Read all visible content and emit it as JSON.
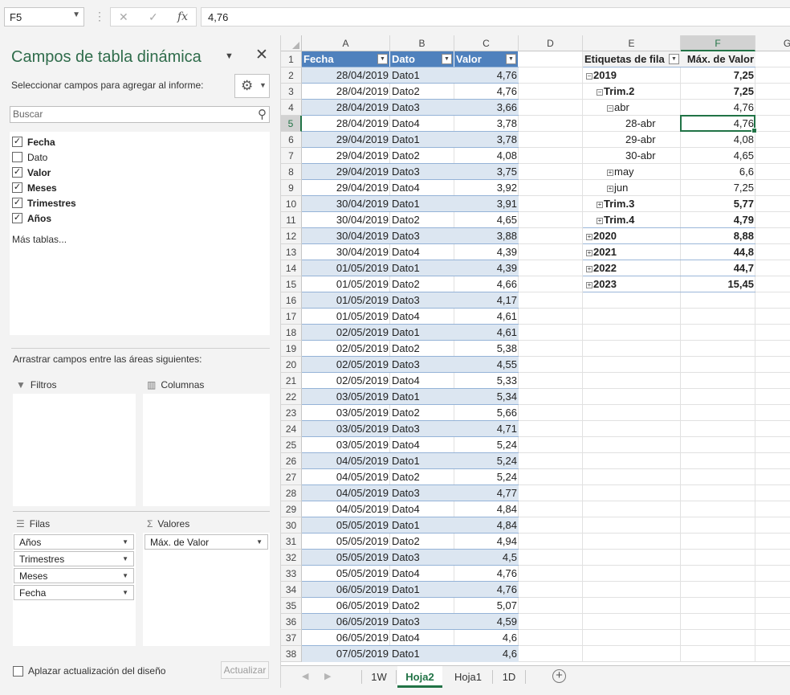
{
  "formula_bar": {
    "name_box": "F5",
    "cancel_icon": "✕",
    "enter_icon": "✓",
    "fx_label": "fx",
    "value": "4,76"
  },
  "pivot_panel": {
    "title": "Campos de tabla dinámica",
    "subtitle": "Seleccionar campos para agregar al informe:",
    "search_placeholder": "Buscar",
    "fields": [
      {
        "label": "Fecha",
        "checked": true
      },
      {
        "label": "Dato",
        "checked": false
      },
      {
        "label": "Valor",
        "checked": true
      },
      {
        "label": "Meses",
        "checked": true
      },
      {
        "label": "Trimestres",
        "checked": true
      },
      {
        "label": "Años",
        "checked": true
      }
    ],
    "more_tables": "Más tablas...",
    "drag_text": "Arrastrar campos entre las áreas siguientes:",
    "areas": {
      "filters": "Filtros",
      "columns": "Columnas",
      "rows": "Filas",
      "values": "Valores"
    },
    "row_fields": [
      "Años",
      "Trimestres",
      "Meses",
      "Fecha"
    ],
    "value_fields": [
      "Máx. de Valor"
    ],
    "defer_label": "Aplazar actualización del diseño",
    "update_label": "Actualizar"
  },
  "sheet": {
    "columns": [
      "A",
      "B",
      "C",
      "D",
      "E",
      "F",
      "G"
    ],
    "table_headers": [
      "Fecha",
      "Dato",
      "Valor"
    ],
    "rows": [
      [
        "28/04/2019",
        "Dato1",
        "4,76"
      ],
      [
        "28/04/2019",
        "Dato2",
        "4,76"
      ],
      [
        "28/04/2019",
        "Dato3",
        "3,66"
      ],
      [
        "28/04/2019",
        "Dato4",
        "3,78"
      ],
      [
        "29/04/2019",
        "Dato1",
        "3,78"
      ],
      [
        "29/04/2019",
        "Dato2",
        "4,08"
      ],
      [
        "29/04/2019",
        "Dato3",
        "3,75"
      ],
      [
        "29/04/2019",
        "Dato4",
        "3,92"
      ],
      [
        "30/04/2019",
        "Dato1",
        "3,91"
      ],
      [
        "30/04/2019",
        "Dato2",
        "4,65"
      ],
      [
        "30/04/2019",
        "Dato3",
        "3,88"
      ],
      [
        "30/04/2019",
        "Dato4",
        "4,39"
      ],
      [
        "01/05/2019",
        "Dato1",
        "4,39"
      ],
      [
        "01/05/2019",
        "Dato2",
        "4,66"
      ],
      [
        "01/05/2019",
        "Dato3",
        "4,17"
      ],
      [
        "01/05/2019",
        "Dato4",
        "4,61"
      ],
      [
        "02/05/2019",
        "Dato1",
        "4,61"
      ],
      [
        "02/05/2019",
        "Dato2",
        "5,38"
      ],
      [
        "02/05/2019",
        "Dato3",
        "4,55"
      ],
      [
        "02/05/2019",
        "Dato4",
        "5,33"
      ],
      [
        "03/05/2019",
        "Dato1",
        "5,34"
      ],
      [
        "03/05/2019",
        "Dato2",
        "5,66"
      ],
      [
        "03/05/2019",
        "Dato3",
        "4,71"
      ],
      [
        "03/05/2019",
        "Dato4",
        "5,24"
      ],
      [
        "04/05/2019",
        "Dato1",
        "5,24"
      ],
      [
        "04/05/2019",
        "Dato2",
        "5,24"
      ],
      [
        "04/05/2019",
        "Dato3",
        "4,77"
      ],
      [
        "04/05/2019",
        "Dato4",
        "4,84"
      ],
      [
        "05/05/2019",
        "Dato1",
        "4,84"
      ],
      [
        "05/05/2019",
        "Dato2",
        "4,94"
      ],
      [
        "05/05/2019",
        "Dato3",
        "4,5"
      ],
      [
        "05/05/2019",
        "Dato4",
        "4,76"
      ],
      [
        "06/05/2019",
        "Dato1",
        "4,76"
      ],
      [
        "06/05/2019",
        "Dato2",
        "5,07"
      ],
      [
        "06/05/2019",
        "Dato3",
        "4,59"
      ],
      [
        "06/05/2019",
        "Dato4",
        "4,6"
      ],
      [
        "07/05/2019",
        "Dato1",
        "4,6"
      ]
    ],
    "pivot": {
      "header_label": "Etiquetas de fila",
      "header_value": "Máx. de Valor",
      "rows": [
        {
          "label": "2019",
          "value": "7,25",
          "level": 0,
          "exp": "−",
          "bold": true
        },
        {
          "label": "Trim.2",
          "value": "7,25",
          "level": 1,
          "exp": "−",
          "bold": true
        },
        {
          "label": "abr",
          "value": "4,76",
          "level": 2,
          "exp": "−",
          "bold": false
        },
        {
          "label": "28-abr",
          "value": "4,76",
          "level": 3,
          "exp": "",
          "bold": false
        },
        {
          "label": "29-abr",
          "value": "4,08",
          "level": 3,
          "exp": "",
          "bold": false
        },
        {
          "label": "30-abr",
          "value": "4,65",
          "level": 3,
          "exp": "",
          "bold": false
        },
        {
          "label": "may",
          "value": "6,6",
          "level": 2,
          "exp": "+",
          "bold": false
        },
        {
          "label": "jun",
          "value": "7,25",
          "level": 2,
          "exp": "+",
          "bold": false
        },
        {
          "label": "Trim.3",
          "value": "5,77",
          "level": 1,
          "exp": "+",
          "bold": true
        },
        {
          "label": "Trim.4",
          "value": "4,79",
          "level": 1,
          "exp": "+",
          "bold": true
        },
        {
          "label": "2020",
          "value": "8,88",
          "level": 0,
          "exp": "+",
          "bold": true
        },
        {
          "label": "2021",
          "value": "44,8",
          "level": 0,
          "exp": "+",
          "bold": true
        },
        {
          "label": "2022",
          "value": "44,7",
          "level": 0,
          "exp": "+",
          "bold": true
        },
        {
          "label": "2023",
          "value": "15,45",
          "level": 0,
          "exp": "+",
          "bold": true
        }
      ]
    }
  },
  "tabs": [
    "1W",
    "Hoja2",
    "Hoja1",
    "1D"
  ],
  "active_tab": "Hoja2",
  "colors": {
    "header_blue": "#4f81bd",
    "band_blue": "#dce6f1",
    "excel_green": "#217346",
    "panel_title": "#2f6c4b"
  }
}
